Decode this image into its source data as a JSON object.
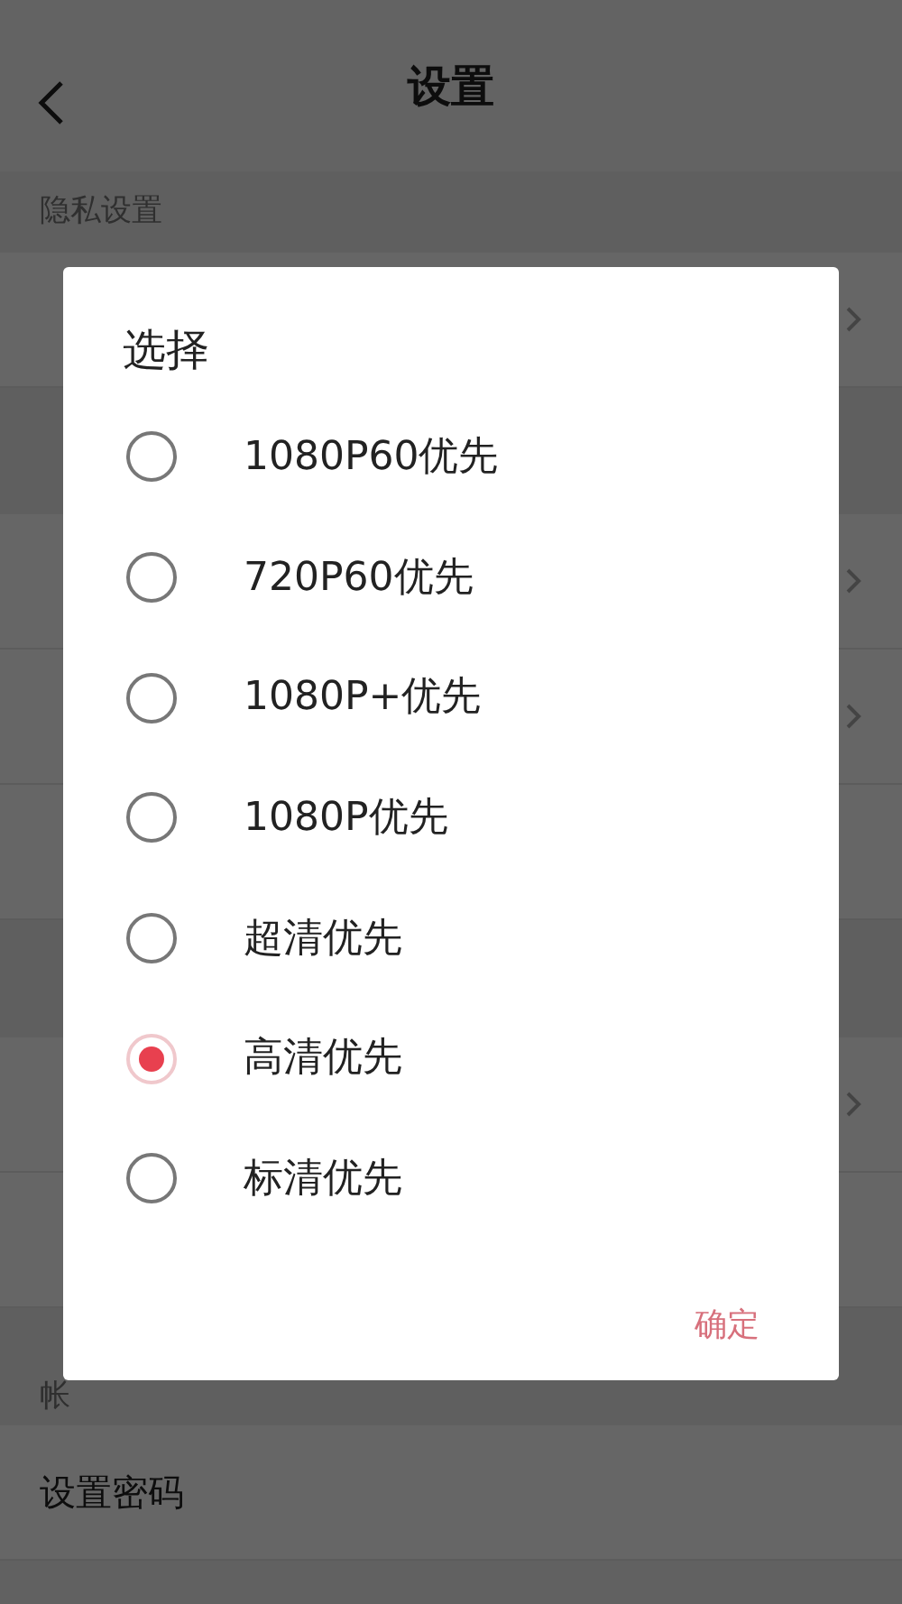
{
  "header": {
    "title": "设置"
  },
  "sections": [
    {
      "title": "隐私设置",
      "items": [
        {
          "chevron": true
        }
      ]
    },
    {
      "items": [
        {
          "chevron": true
        },
        {
          "chevron": true
        },
        {
          "chevron": false
        }
      ]
    },
    {
      "items": [
        {
          "chevron": true
        },
        {
          "chevron": false
        }
      ]
    },
    {
      "title": "帐",
      "items": [
        {
          "label": "设置密码",
          "chevron": false
        }
      ]
    }
  ],
  "dialog": {
    "title": "选择",
    "options": [
      {
        "label": "1080P60优先",
        "selected": false
      },
      {
        "label": "720P60优先",
        "selected": false
      },
      {
        "label": "1080P+优先",
        "selected": false
      },
      {
        "label": "1080P优先",
        "selected": false
      },
      {
        "label": "超清优先",
        "selected": false
      },
      {
        "label": "高清优先",
        "selected": true
      },
      {
        "label": "标清优先",
        "selected": false
      }
    ],
    "confirm": "确定"
  }
}
